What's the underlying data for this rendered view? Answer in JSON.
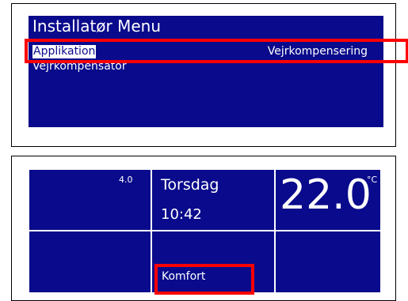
{
  "installer_menu": {
    "title": "Installatør Menu",
    "items": [
      {
        "label": "Applikation",
        "value": "Vejrkompensering",
        "selected": true
      },
      {
        "label": "Vejrkompensator",
        "value": ""
      }
    ]
  },
  "status_display": {
    "small_value": "4.0",
    "day": "Torsdag",
    "time": "10:42",
    "temperature": "22.0",
    "unit": "°C",
    "mode": "Komfort"
  },
  "colors": {
    "screen_blue": "#0a0a8c",
    "highlight_red": "#ff0000",
    "text": "#ffffff"
  }
}
